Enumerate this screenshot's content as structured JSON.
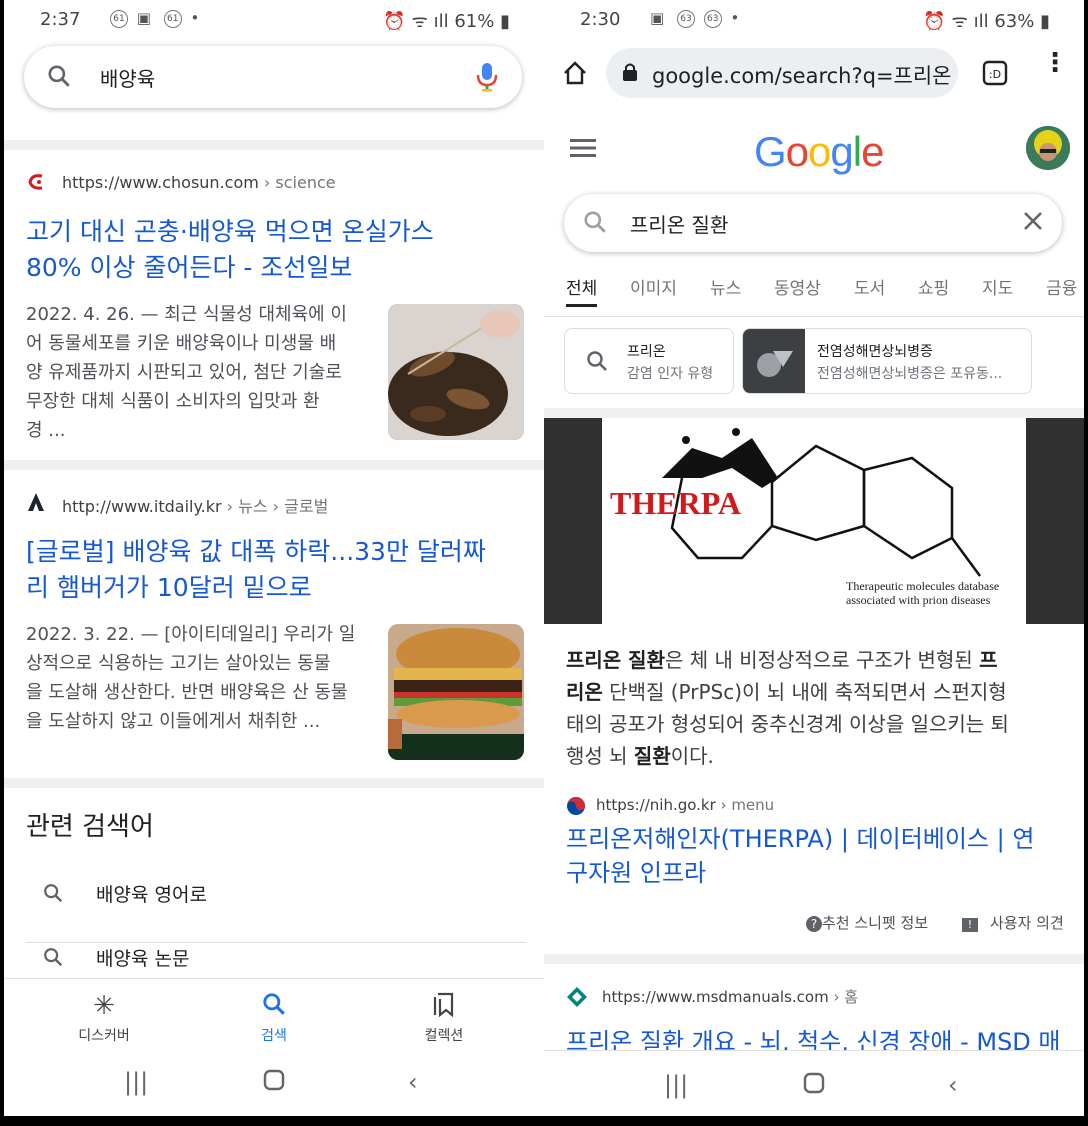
{
  "left": {
    "status": {
      "time": "2:37",
      "notif": "61",
      "battery": "61%"
    },
    "search": {
      "query": "배양육"
    },
    "results": [
      {
        "site": "https://www.chosun.com",
        "crumb": " › science",
        "title_line1": "고기 대신 곤충·배양육 먹으면 온실가스",
        "title_line2": "80% 이상 줄어든다 - 조선일보",
        "snippet_lines": [
          "2022. 4. 26. — 최근 식물성 대체육에 이",
          "어 동물세포를 키운 배양육이나 미생물 배",
          "양 유제품까지 시판되고 있어, 첨단 기술로",
          "무장한 대체 식품이 소비자의 입맛과 환",
          "경 ..."
        ]
      },
      {
        "site": "http://www.itdaily.kr",
        "crumb": " › 뉴스 › 글로벌",
        "title_line1": "[글로벌] 배양육 값 대폭 하락...33만 달러짜",
        "title_line2": "리 햄버거가 10달러 밑으로",
        "snippet_lines": [
          "2022. 3. 22. — [아이티데일리] 우리가 일",
          "상적으로 식용하는 고기는 살아있는 동물",
          "을 도살해 생산한다. 반면 배양육은 산 동물",
          "을 도살하지 않고 이들에게서 채취한 ..."
        ]
      }
    ],
    "related_heading": "관련 검색어",
    "related": [
      "배양육 영어로",
      "배양육 논문"
    ],
    "bottom_nav": {
      "discover": "디스커버",
      "search": "검색",
      "collections": "컬렉션"
    },
    "colors": {
      "accent": "#1a73e8",
      "link": "#1558d6"
    }
  },
  "right": {
    "status": {
      "time": "2:30",
      "notif": "63",
      "battery": "63%"
    },
    "url": "google.com/search?q=프리온",
    "logo": {
      "letters": [
        "G",
        "o",
        "o",
        "g",
        "l",
        "e"
      ],
      "colors": [
        "#4285F4",
        "#EA4335",
        "#FBBC05",
        "#4285F4",
        "#34A853",
        "#EA4335"
      ]
    },
    "search": {
      "query": "프리온 질환"
    },
    "tabs": [
      "전체",
      "이미지",
      "뉴스",
      "동영상",
      "도서",
      "쇼핑",
      "지도",
      "금융"
    ],
    "chips": [
      {
        "title": "프리온",
        "sub": "감염 인자 유형"
      },
      {
        "title": "전염성해면상뇌병증",
        "sub": "전염성해면상뇌병증은 포유동..."
      }
    ],
    "hero": {
      "brand": "THERPA",
      "caption1": "Therapeutic molecules database",
      "caption2": "associated with prion diseases"
    },
    "para": {
      "line1_b": "프리온 질환",
      "line1": "은 체 내 비정상적으로 구조가 변형된 ",
      "line1_b2": "프",
      "line2_b": "리온",
      "line2": " 단백질 (PrPSc)이 뇌 내에 축적되면서 스펀지형",
      "line3": "태의 공포가 형성되어 중추신경계 이상을 일으키는 퇴",
      "line4_a": "행성 뇌 ",
      "line4_b": "질환",
      "line4_c": "이다."
    },
    "source": {
      "site": "https://nih.go.kr",
      "crumb": " › menu",
      "title1": "프리온저해인자(THERPA) | 데이터베이스 | 연",
      "title2": "구자원 인프라"
    },
    "feedback": {
      "about": "추천 스니펫 정보",
      "user": "사용자 의견"
    },
    "next": {
      "site": "https://www.msdmanuals.com",
      "crumb": " › 홈",
      "title": "프리온 질환 개요 - 뇌, 척수, 신경 장애 - MSD 매"
    }
  }
}
